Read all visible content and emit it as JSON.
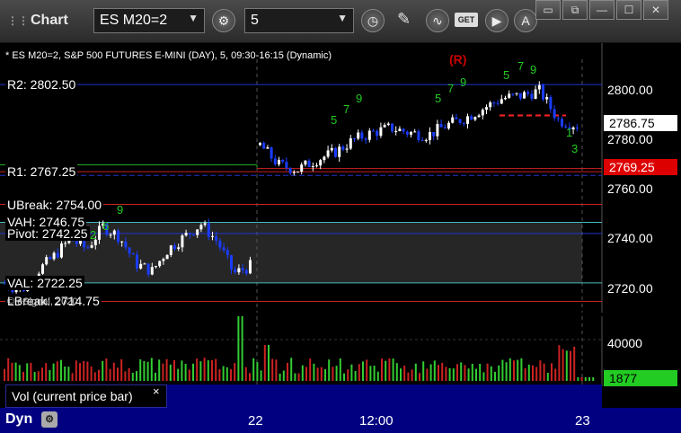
{
  "toolbar": {
    "app_title": "Chart",
    "symbol_value": "ES M20=2",
    "interval_value": "5",
    "get_label": "GET",
    "icons": [
      "gear-icon",
      "clock-icon",
      "pencil-icon",
      "study-icon",
      "get-icon",
      "play-icon",
      "alert-icon"
    ]
  },
  "window": {
    "buttons": [
      "restore-icon",
      "link-icon",
      "minimize-icon",
      "maximize-icon",
      "close-icon"
    ]
  },
  "chart": {
    "header": "* ES M20=2, S&P 500 FUTURES E-MINI (DAY), 5, 09:30-16:15 (Dynamic)",
    "annotation": "(R)",
    "copyright": "© eSignal, 2020",
    "levels": [
      {
        "label": "R2: 2802.50",
        "value": 2802.5,
        "color": "#2233cc"
      },
      {
        "label": "R1: 2767.25",
        "value": 2767.25,
        "color": "#cc2222"
      },
      {
        "label": "UBreak: 2754.00",
        "value": 2754.0,
        "color": "#cc2222"
      },
      {
        "label": "VAH: 2746.75",
        "value": 2746.75,
        "color": "#44bbbb"
      },
      {
        "label": "Pivot: 2742.25",
        "value": 2742.25,
        "color": "#2233cc"
      },
      {
        "label": "VAL: 2722.25",
        "value": 2722.25,
        "color": "#44bbbb"
      },
      {
        "label": "LBreak: 2714.75",
        "value": 2714.75,
        "color": "#cc2222"
      }
    ],
    "price_ticks": [
      "2800.00",
      "2780.00",
      "2760.00",
      "2740.00",
      "2720.00"
    ],
    "last_price": "2786.75",
    "red_tag": "2769.25",
    "time_ticks": [
      "22",
      "12:00",
      "23"
    ],
    "colors": {
      "up": "#ffffff",
      "down": "#1a3cff",
      "grid": "#2a2a2a",
      "volume_up": "#33cc33",
      "volume_down": "#cc2222"
    }
  },
  "volume": {
    "label": "Vol (current price bar)",
    "close_glyph": "×",
    "tick": "40000",
    "current": "1877"
  },
  "footer": {
    "dyn_label": "Dyn"
  }
}
